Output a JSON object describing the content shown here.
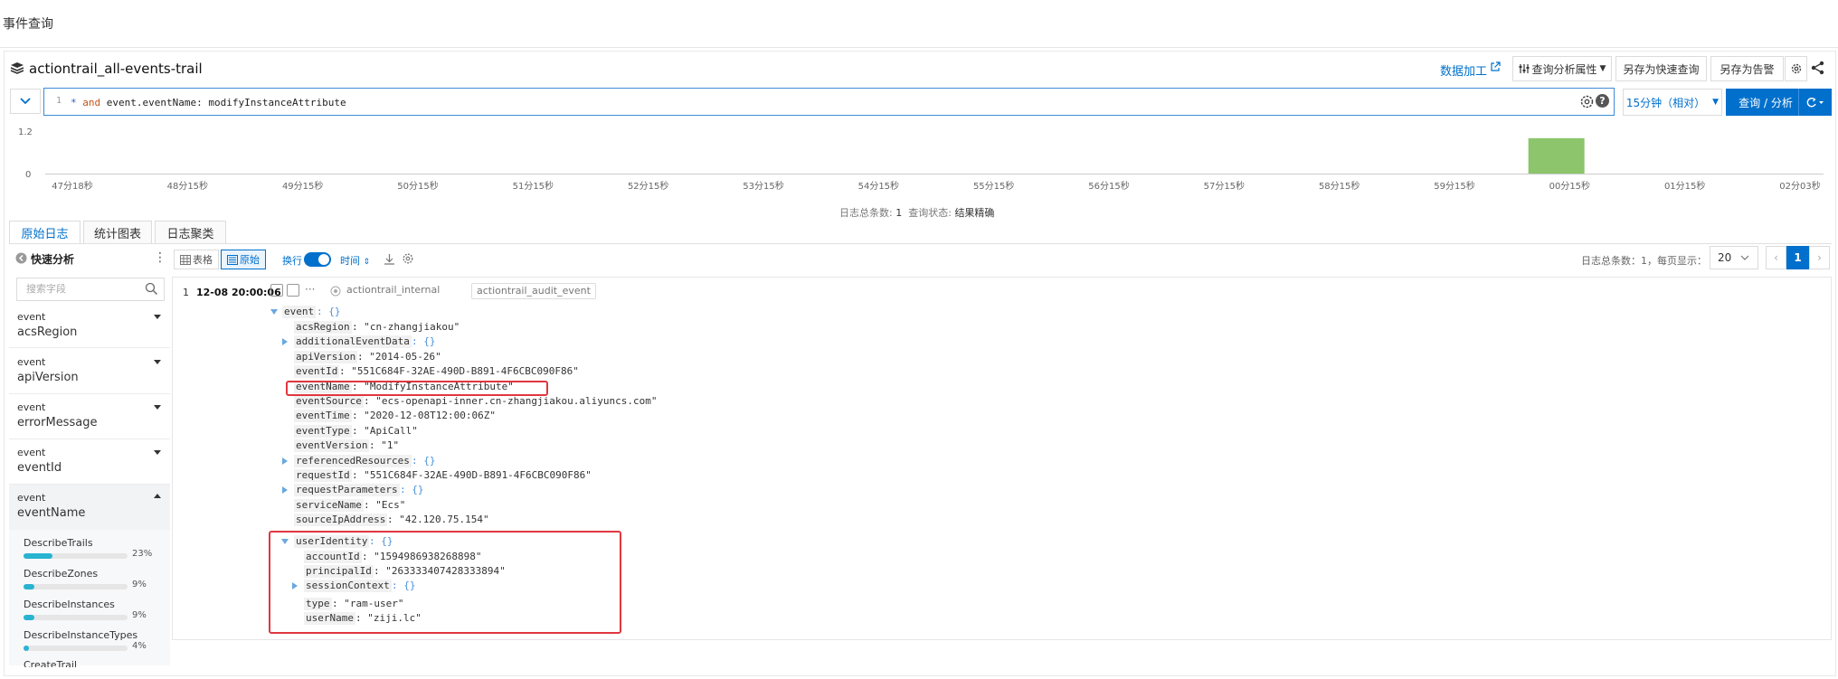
{
  "page": {
    "title": "事件查询"
  },
  "header": {
    "store_name": "actiontrail_all-events-trail",
    "data_process": "数据加工",
    "props_btn": "查询分析属性",
    "quick_query_btn": "另存为快速查询",
    "alert_btn": "另存为告警"
  },
  "query": {
    "line_no": "1",
    "star": "*",
    "keyword": "and",
    "text": " event.eventName: modifyInstanceAttribute",
    "time_range": "15分钟（相对）",
    "search_btn": "查询 / 分析"
  },
  "histogram": {
    "y_max_label": "1.2",
    "y_min_label": "0",
    "x_labels": [
      "47分18秒",
      "48分15秒",
      "49分15秒",
      "50分15秒",
      "51分15秒",
      "52分15秒",
      "53分15秒",
      "54分15秒",
      "55分15秒",
      "56分15秒",
      "57分15秒",
      "58分15秒",
      "59分15秒",
      "00分15秒",
      "01分15秒",
      "02分03秒"
    ],
    "bar_index": 13,
    "bar_value": 1,
    "bar_color": "#8cc56b",
    "summary_total_label": "日志总条数:",
    "summary_total": "1",
    "summary_status_label": "查询状态:",
    "summary_status": "结果精确"
  },
  "tabs": [
    "原始日志",
    "统计图表",
    "日志聚类"
  ],
  "quick_analysis": {
    "title": "快速分析",
    "search_placeholder": "搜索字段",
    "fields": [
      {
        "group": "event",
        "name": "acsRegion"
      },
      {
        "group": "event",
        "name": "apiVersion"
      },
      {
        "group": "event",
        "name": "errorMessage"
      },
      {
        "group": "event",
        "name": "eventId"
      },
      {
        "group": "event",
        "name": "eventName"
      }
    ],
    "values": [
      {
        "label": "DescribeTrails",
        "pct": "23%",
        "frac": 0.23
      },
      {
        "label": "DescribeZones",
        "pct": "9%",
        "frac": 0.09
      },
      {
        "label": "DescribeInstances",
        "pct": "9%",
        "frac": 0.09
      },
      {
        "label": "DescribeInstanceTypes",
        "pct": "4%",
        "frac": 0.04
      }
    ],
    "partial_label": "CreateTrail"
  },
  "toolbar": {
    "table": "表格",
    "raw": "原始",
    "wrap": "换行",
    "sort": "时间",
    "total_text": "日志总条数：1，每页显示：",
    "page_size": "20",
    "current_page": "1"
  },
  "log": {
    "num": "1",
    "time": "12-08 20:00:06",
    "tag1": "actiontrail_internal",
    "tag2": "actiontrail_audit_event",
    "event_key": "event",
    "braces": ": {}",
    "rows": [
      {
        "k": "acsRegion",
        "v": ": \"cn-zhangjiakou\""
      },
      {
        "k": "additionalEventData",
        "v": ": {}"
      },
      {
        "k": "apiVersion",
        "v": ": \"2014-05-26\""
      },
      {
        "k": "eventId",
        "v": ": \"551C684F-32AE-490D-B891-4F6CBC090F86\""
      },
      {
        "k": "eventName",
        "v": ": \"ModifyInstanceAttribute\""
      },
      {
        "k": "eventSource",
        "v": ": \"ecs-openapi-inner.cn-zhangjiakou.aliyuncs.com\""
      },
      {
        "k": "eventTime",
        "v": ": \"2020-12-08T12:00:06Z\""
      },
      {
        "k": "eventType",
        "v": ": \"ApiCall\""
      },
      {
        "k": "eventVersion",
        "v": ": \"1\""
      },
      {
        "k": "referencedResources",
        "v": ": {}"
      },
      {
        "k": "requestId",
        "v": ": \"551C684F-32AE-490D-B891-4F6CBC090F86\""
      },
      {
        "k": "requestParameters",
        "v": ": {}"
      },
      {
        "k": "serviceName",
        "v": ": \"Ecs\""
      },
      {
        "k": "sourceIpAddress",
        "v": ": \"42.120.75.154\""
      },
      {
        "k": "userIdentity",
        "v": ": {}"
      }
    ],
    "user_rows": [
      {
        "k": "accountId",
        "v": ": \"1594986938268898\""
      },
      {
        "k": "principalId",
        "v": ": \"263333407428333894\""
      },
      {
        "k": "sessionContext",
        "v": ": {}"
      },
      {
        "k": "type",
        "v": ": \"ram-user\""
      },
      {
        "k": "userName",
        "v": ": \"ziji.lc\""
      }
    ]
  }
}
